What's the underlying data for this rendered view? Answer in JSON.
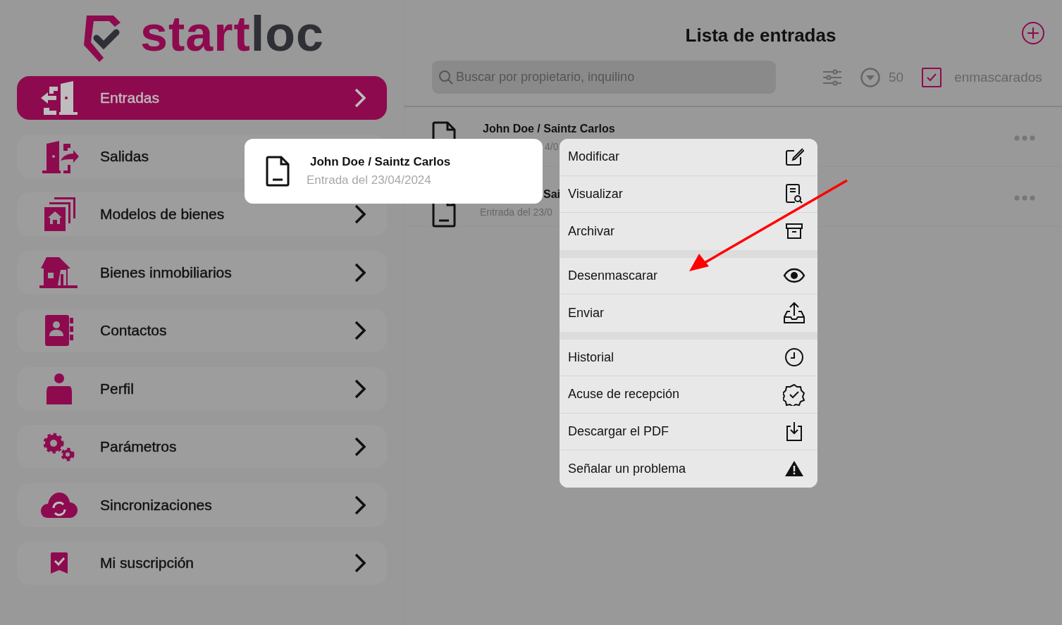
{
  "logo": {
    "primary": "start",
    "secondary": "loc"
  },
  "sidebar": {
    "items": [
      {
        "label": "Entradas",
        "kind": "entry",
        "selected": true
      },
      {
        "label": "Salidas",
        "kind": "exit",
        "selected": false
      },
      {
        "label": "Modelos de bienes",
        "kind": "models",
        "selected": false
      },
      {
        "label": "Bienes inmobiliarios",
        "kind": "house",
        "selected": false
      },
      {
        "label": "Contactos",
        "kind": "contacts",
        "selected": false
      },
      {
        "label": "Perfil",
        "kind": "profile",
        "selected": false
      },
      {
        "label": "Parámetros",
        "kind": "gears",
        "selected": false
      },
      {
        "label": "Sincronizaciones",
        "kind": "sync",
        "selected": false
      },
      {
        "label": "Mi suscripción",
        "kind": "subscription",
        "selected": false
      }
    ]
  },
  "header": {
    "title": "Lista de entradas"
  },
  "search": {
    "placeholder": "Buscar por propietario, inquilino"
  },
  "page_size": "50",
  "masked_filter": {
    "label": "enmascarados",
    "checked": true
  },
  "list": {
    "rows": [
      {
        "title": "John Doe / Saintz Carlos",
        "subtitle": "4/0"
      },
      {
        "title": "Sai",
        "subtitle": "Entrada del 23/0"
      }
    ]
  },
  "preview_card": {
    "title": "John Doe / Saintz Carlos",
    "subtitle": "Entrada del 23/04/2024"
  },
  "context_menu": {
    "groups": [
      {
        "items": [
          {
            "label": "Modificar",
            "kind": "edit"
          },
          {
            "label": "Visualizar",
            "kind": "view"
          },
          {
            "label": "Archivar",
            "kind": "archive"
          }
        ]
      },
      {
        "items": [
          {
            "label": "Desenmascarar",
            "kind": "eye"
          },
          {
            "label": "Enviar",
            "kind": "send"
          }
        ]
      },
      {
        "items": [
          {
            "label": "Historial",
            "kind": "clock"
          },
          {
            "label": "Acuse de recepción",
            "kind": "badge"
          },
          {
            "label": "Descargar el PDF",
            "kind": "download"
          },
          {
            "label": "Señalar un problema",
            "kind": "warning"
          }
        ]
      }
    ]
  }
}
